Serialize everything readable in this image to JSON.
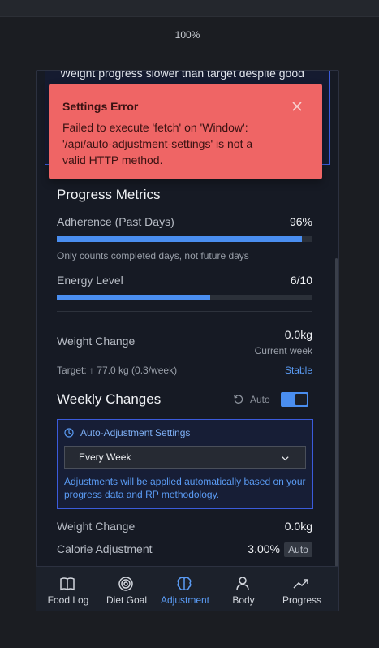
{
  "browser": {
    "zoom": "100%"
  },
  "insight": {
    "text": "Weight progress slower than target despite good"
  },
  "toast": {
    "title": "Settings Error",
    "message": "Failed to execute 'fetch' on 'Window': '/api/auto-adjustment-settings' is not a valid HTTP method.",
    "close_icon": "close-icon"
  },
  "progress_metrics": {
    "title": "Progress Metrics",
    "adherence": {
      "label": "Adherence (Past Days)",
      "value": "96%",
      "percent": 96,
      "note": "Only counts completed days, not future days"
    },
    "energy": {
      "label": "Energy Level",
      "value": "6/10",
      "fraction": 0.6
    },
    "weight_change": {
      "label": "Weight Change",
      "value": "0.0kg",
      "period": "Current week"
    },
    "target": {
      "text": "Target: ↑ 77.0 kg (0.3/week)",
      "status": "Stable"
    }
  },
  "weekly_changes": {
    "title": "Weekly Changes",
    "auto_label": "Auto",
    "toggle_on": true,
    "auto_settings": {
      "title": "Auto-Adjustment Settings",
      "frequency": "Every Week",
      "note": "Adjustments will be applied automatically based on your progress data and RP methodology."
    },
    "weight_change": {
      "label": "Weight Change",
      "value": "0.0kg"
    },
    "calorie_adjustment": {
      "label": "Calorie Adjustment",
      "value": "3.00%",
      "badge": "Auto"
    }
  },
  "nav": {
    "items": [
      {
        "label": "Food Log",
        "icon": "book-icon",
        "active": false
      },
      {
        "label": "Diet Goal",
        "icon": "target-icon",
        "active": false
      },
      {
        "label": "Adjustment",
        "icon": "brain-icon",
        "active": true
      },
      {
        "label": "Body",
        "icon": "user-icon",
        "active": false
      },
      {
        "label": "Progress",
        "icon": "trending-up-icon",
        "active": false
      }
    ]
  },
  "colors": {
    "accent": "#4a8ef0",
    "error": "#ef6565",
    "background": "#161a24"
  }
}
